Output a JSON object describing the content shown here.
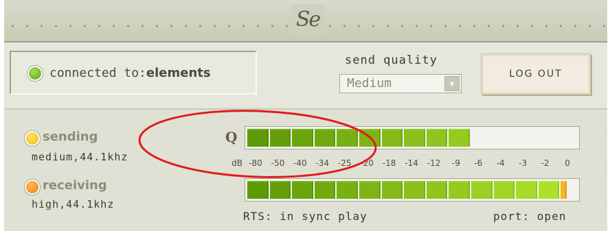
{
  "app": {
    "logo_text": "Se"
  },
  "connection": {
    "prefix": "connected to:",
    "name": "elements",
    "status_color": "#6cb424"
  },
  "send_quality": {
    "label": "send quality",
    "value": "Medium"
  },
  "logout_label": "LOG OUT",
  "sending": {
    "label": "sending",
    "detail": "medium,44.1khz",
    "led_color": "#f7c81b",
    "q_mark": "Q",
    "level_segments": 10,
    "total_segments": 14
  },
  "receiving": {
    "label": "receiving",
    "detail": "high,44.1khz",
    "led_color": "#f28c0f",
    "level_segments": 14,
    "total_segments": 14,
    "peak_indicator": true
  },
  "db_scale": {
    "unit": "dB",
    "ticks": [
      "-80",
      "-50",
      "-40",
      "-34",
      "-25",
      "-20",
      "-18",
      "-14",
      "-12",
      "-9",
      "-6",
      "-4",
      "-3",
      "-2",
      "0"
    ]
  },
  "status": {
    "rts": "RTS: in sync play",
    "port": "port: open"
  },
  "colors": {
    "meter_dark": "#5e9a07",
    "meter_light": "#aee02a",
    "peak": "#f5b521",
    "annotation": "#e01c1c"
  }
}
